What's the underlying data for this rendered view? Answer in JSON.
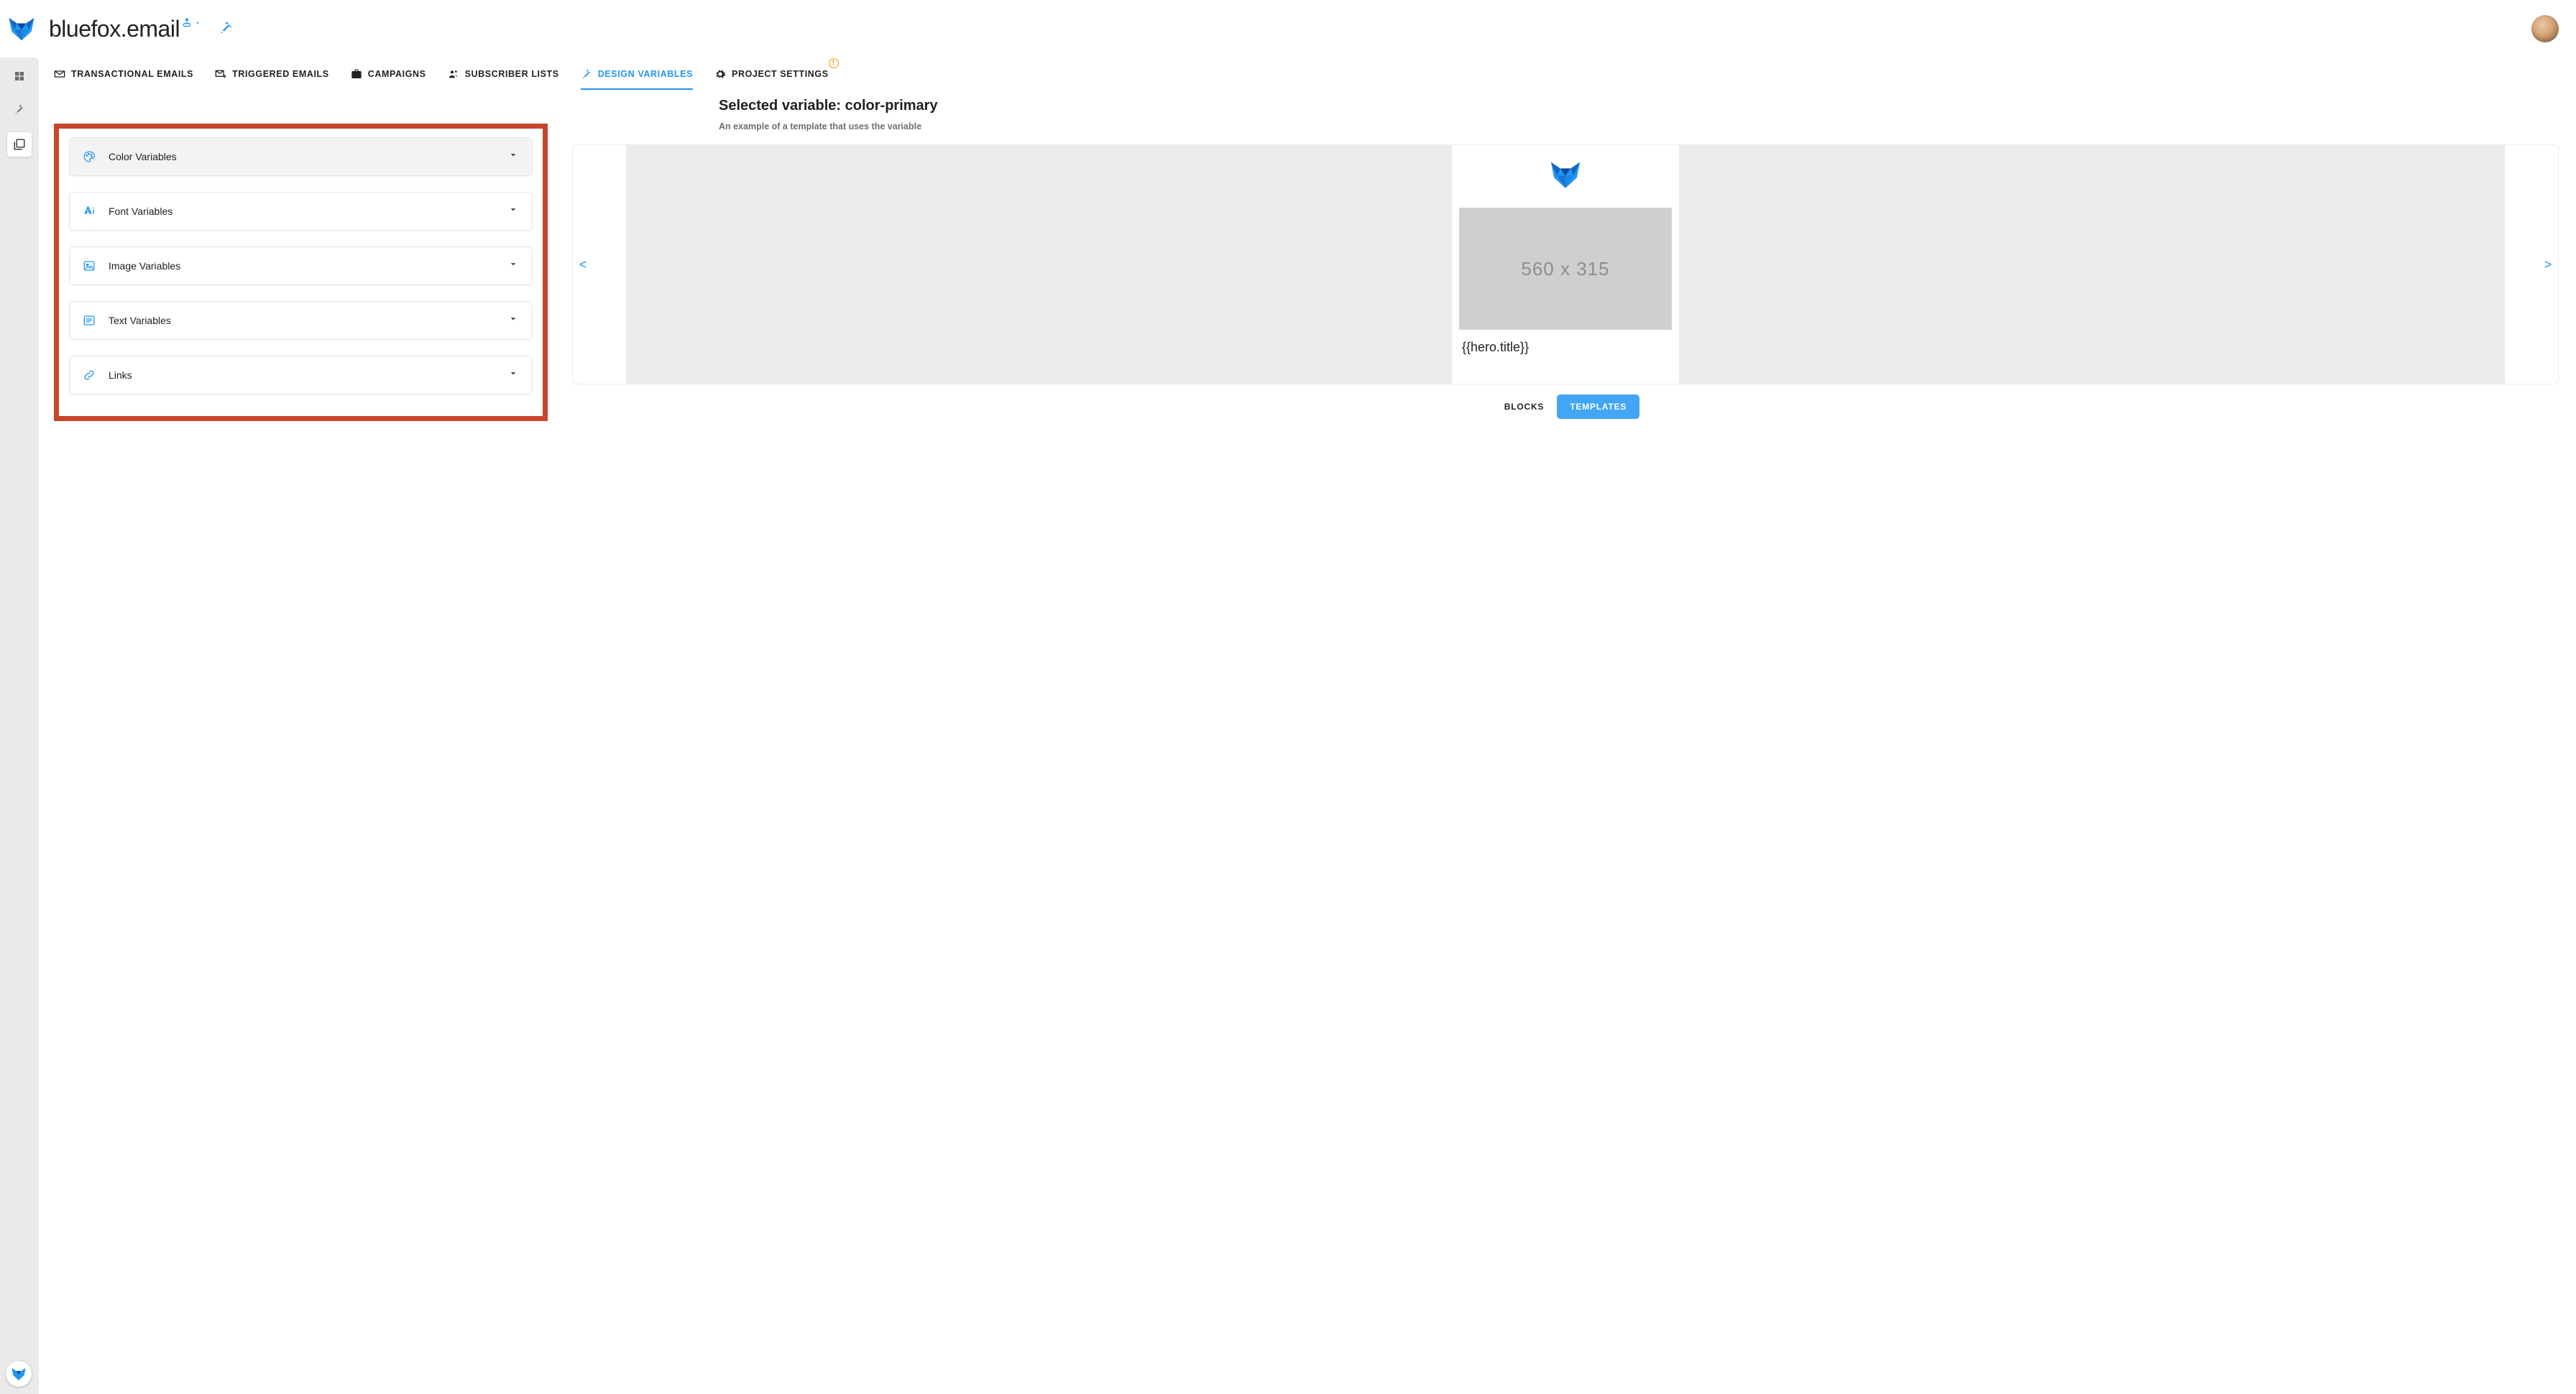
{
  "header": {
    "project_name": "bluefox.email"
  },
  "tabs": [
    {
      "id": "transactional",
      "label": "TRANSACTIONAL EMAILS",
      "active": false
    },
    {
      "id": "triggered",
      "label": "TRIGGERED EMAILS",
      "active": false
    },
    {
      "id": "campaigns",
      "label": "CAMPAIGNS",
      "active": false
    },
    {
      "id": "subscribers",
      "label": "SUBSCRIBER LISTS",
      "active": false
    },
    {
      "id": "design-vars",
      "label": "DESIGN VARIABLES",
      "active": true
    },
    {
      "id": "settings",
      "label": "PROJECT SETTINGS",
      "active": false,
      "alert": true
    }
  ],
  "variable_groups": [
    {
      "id": "color",
      "label": "Color Variables",
      "hover": true
    },
    {
      "id": "font",
      "label": "Font Variables",
      "hover": false
    },
    {
      "id": "image",
      "label": "Image Variables",
      "hover": false
    },
    {
      "id": "text",
      "label": "Text Variables",
      "hover": false
    },
    {
      "id": "links",
      "label": "Links",
      "hover": false
    }
  ],
  "preview": {
    "title": "Selected variable: color-primary",
    "subtitle": "An example of a template that uses the variable",
    "placeholder_text": "560 x 315",
    "hero_title": "{{hero.title}}",
    "nav_prev": "<",
    "nav_next": ">",
    "toggles": {
      "blocks": "BLOCKS",
      "templates": "TEMPLATES",
      "active": "templates"
    }
  },
  "colors": {
    "accent": "#2196F3",
    "highlight_border": "#C7462B",
    "warning": "#FF9800"
  }
}
